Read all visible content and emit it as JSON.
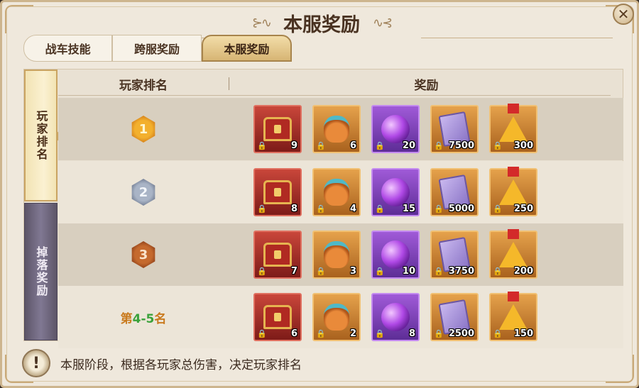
{
  "window": {
    "title": "本服奖励",
    "close_label": "✕"
  },
  "tabs": [
    {
      "label": "战车技能",
      "active": false
    },
    {
      "label": "跨服奖励",
      "active": false
    },
    {
      "label": "本服奖励",
      "active": true
    }
  ],
  "side_tabs": [
    {
      "label": "玩家排名",
      "active": true
    },
    {
      "label": "掉落奖励",
      "active": false
    }
  ],
  "table": {
    "headers": {
      "rank": "玩家排名",
      "reward": "奖励"
    },
    "rows": [
      {
        "rank_badge": "1",
        "rank_style": "gold",
        "items": [
          {
            "icon": "treasure-chest-icon",
            "color": "red",
            "qty": "9"
          },
          {
            "icon": "resource-bag-icon",
            "color": "orange",
            "qty": "6"
          },
          {
            "icon": "purple-orb-icon",
            "color": "purple",
            "qty": "20"
          },
          {
            "icon": "skill-book-icon",
            "color": "orange",
            "qty": "7500"
          },
          {
            "icon": "star-medal-icon",
            "color": "orange",
            "qty": "300"
          }
        ]
      },
      {
        "rank_badge": "2",
        "rank_style": "silver",
        "items": [
          {
            "icon": "treasure-chest-icon",
            "color": "red",
            "qty": "8"
          },
          {
            "icon": "resource-bag-icon",
            "color": "orange",
            "qty": "4"
          },
          {
            "icon": "purple-orb-icon",
            "color": "purple",
            "qty": "15"
          },
          {
            "icon": "skill-book-icon",
            "color": "orange",
            "qty": "5000"
          },
          {
            "icon": "star-medal-icon",
            "color": "orange",
            "qty": "250"
          }
        ]
      },
      {
        "rank_badge": "3",
        "rank_style": "bronze",
        "items": [
          {
            "icon": "treasure-chest-icon",
            "color": "red",
            "qty": "7"
          },
          {
            "icon": "resource-bag-icon",
            "color": "orange",
            "qty": "3"
          },
          {
            "icon": "purple-orb-icon",
            "color": "purple",
            "qty": "10"
          },
          {
            "icon": "skill-book-icon",
            "color": "orange",
            "qty": "3750"
          },
          {
            "icon": "star-medal-icon",
            "color": "orange",
            "qty": "200"
          }
        ]
      },
      {
        "rank_text_prefix": "第",
        "rank_text_range": "4-5",
        "rank_text_suffix": "名",
        "items": [
          {
            "icon": "treasure-chest-icon",
            "color": "red",
            "qty": "6"
          },
          {
            "icon": "resource-bag-icon",
            "color": "orange",
            "qty": "2"
          },
          {
            "icon": "purple-orb-icon",
            "color": "purple",
            "qty": "8"
          },
          {
            "icon": "skill-book-icon",
            "color": "orange",
            "qty": "2500"
          },
          {
            "icon": "star-medal-icon",
            "color": "orange",
            "qty": "150"
          }
        ]
      }
    ]
  },
  "footer": {
    "info_icon": "!",
    "text": "本服阶段，根据各玩家总伤害，决定玩家排名"
  },
  "colors": {
    "panel_bg": "#efe8dc",
    "rank_gold": "#f3b02d",
    "rank_text_orange": "#c97a1e",
    "rank_text_green": "#3aa23a",
    "side_tab_inactive": "#807893"
  }
}
